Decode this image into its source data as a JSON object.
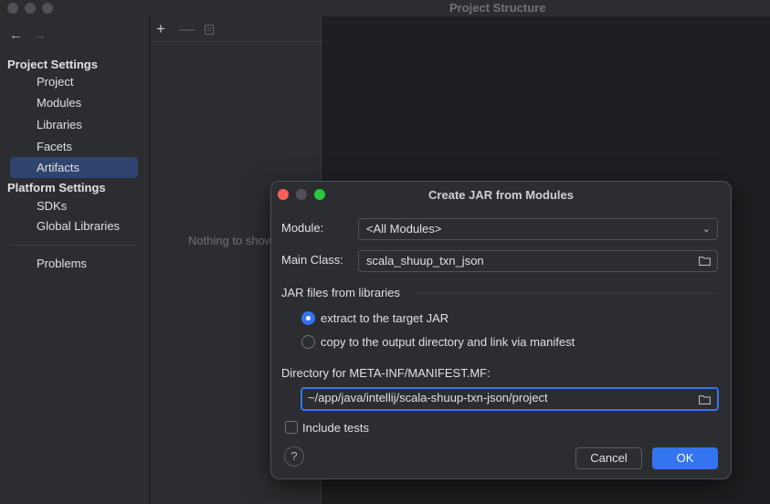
{
  "window": {
    "title": "Project Structure"
  },
  "nav": {
    "back_icon": "arrow-left-icon",
    "forward_icon": "arrow-right-icon"
  },
  "sidebar": {
    "project_settings_heading": "Project Settings",
    "project_settings_items": [
      {
        "label": "Project"
      },
      {
        "label": "Modules"
      },
      {
        "label": "Libraries"
      },
      {
        "label": "Facets"
      },
      {
        "label": "Artifacts",
        "selected": true
      }
    ],
    "platform_settings_heading": "Platform Settings",
    "platform_settings_items": [
      {
        "label": "SDKs"
      },
      {
        "label": "Global Libraries"
      }
    ],
    "problems_label": "Problems"
  },
  "artifacts_panel": {
    "add_icon": "plus-icon",
    "remove_icon": "minus-icon",
    "copy_icon": "copy-icon",
    "empty_text": "Nothing to show"
  },
  "dialog": {
    "title": "Create JAR from Modules",
    "module_label": "Module:",
    "module_value": "<All Modules>",
    "main_class_label": "Main Class:",
    "main_class_value": "scala_shuup_txn_json",
    "jar_files_label": "JAR files from libraries",
    "option_extract": "extract to the target JAR",
    "option_copy": "copy to the output directory and link via manifest",
    "selected_option": "extract",
    "manifest_dir_label": "Directory for META-INF/MANIFEST.MF:",
    "manifest_dir_value": "~/app/java/intellij/scala-shuup-txn-json/project",
    "include_tests_label": "Include tests",
    "include_tests_checked": false,
    "help_label": "?",
    "cancel_label": "Cancel",
    "ok_label": "OK"
  },
  "colors": {
    "accent": "#3574f0",
    "selection": "#2e436e",
    "close": "#ff5f57",
    "minimize_inactive": "#4e5157",
    "zoom": "#28c840"
  }
}
